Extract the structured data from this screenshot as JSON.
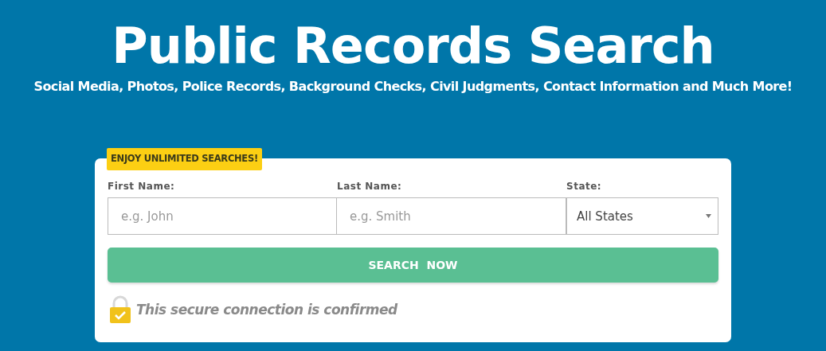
{
  "title": "Public Records Search",
  "subtitle": "Social Media, Photos, Police Records, Background Checks, Civil Judgments, Contact Information and Much More!",
  "form": {
    "badge": "ENJOY UNLIMITED SEARCHES!",
    "fields": [
      {
        "kind": "text",
        "label": "First Name:",
        "placeholder": "e.g. John"
      },
      {
        "kind": "text",
        "label": "Last Name:",
        "placeholder": "e.g. Smith"
      },
      {
        "kind": "select",
        "label": "State:",
        "value": "All States"
      }
    ],
    "button": "SEARCH  NOW",
    "secure_note": "This secure connection is confirmed"
  }
}
